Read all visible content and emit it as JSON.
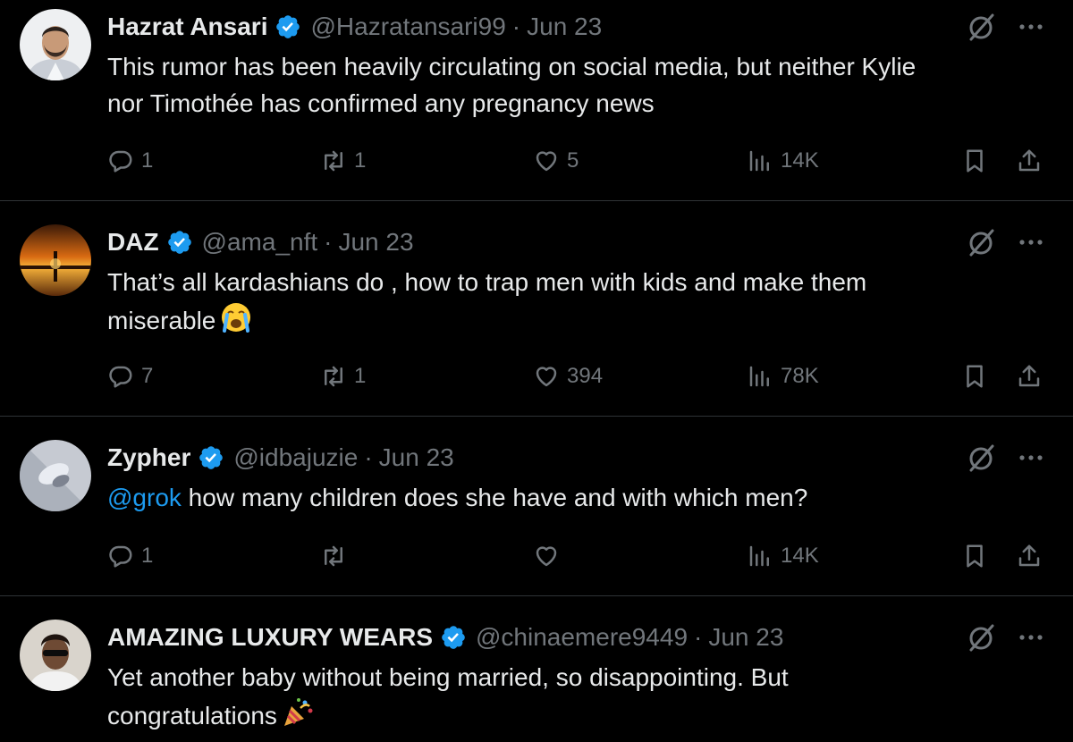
{
  "tweets": [
    {
      "name": "Hazrat Ansari",
      "handle": "@Hazratansari99",
      "separator": "·",
      "date": "Jun 23",
      "text_lines": [
        "This rumor has been heavily circulating on social media, but neither Kylie",
        "nor Timothée has confirmed any pregnancy news"
      ],
      "replies": "1",
      "reposts": "1",
      "likes": "5",
      "views": "14K"
    },
    {
      "name": "DAZ",
      "handle": "@ama_nft",
      "separator": "·",
      "date": "Jun 23",
      "text_lines": [
        "That’s all kardashians do , how to trap men with kids and make them",
        "miserable"
      ],
      "emoji": "loudly-crying-face",
      "replies": "7",
      "reposts": "1",
      "likes": "394",
      "views": "78K"
    },
    {
      "name": "Zypher",
      "handle": "@idbajuzie",
      "separator": "·",
      "date": "Jun 23",
      "mention": "@grok",
      "text": " how many children does she have and with which men?",
      "replies": "1",
      "reposts": "",
      "likes": "",
      "views": "14K"
    },
    {
      "name": "AMAZING LUXURY WEARS",
      "handle": "@chinaemere9449",
      "separator": "·",
      "date": "Jun 23",
      "text_lines": [
        "Yet another baby without being married, so disappointing. But",
        "congratulations"
      ],
      "emoji": "party-popper"
    }
  ],
  "icons": {
    "verified": "verified-badge-icon",
    "grok": "grok-icon",
    "more": "more-icon",
    "reply": "reply-icon",
    "repost": "repost-icon",
    "like": "heart-icon",
    "views": "views-icon",
    "bookmark": "bookmark-icon",
    "share": "share-icon"
  },
  "colors": {
    "background": "#000000",
    "text": "#e7e9ea",
    "secondary": "#71767b",
    "accent": "#1d9bf0",
    "divider": "#2f3336"
  }
}
